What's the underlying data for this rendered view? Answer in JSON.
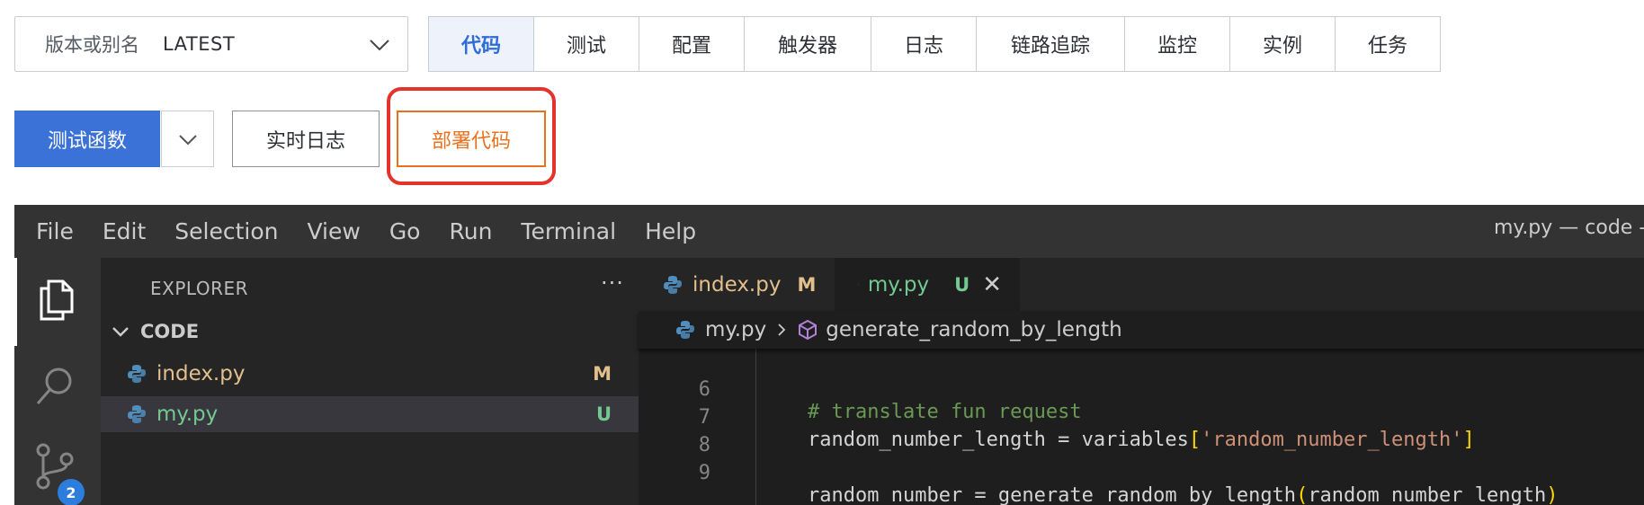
{
  "version_select": {
    "label": "版本或别名",
    "value": "LATEST"
  },
  "tabs": [
    "代码",
    "测试",
    "配置",
    "触发器",
    "日志",
    "链路追踪",
    "监控",
    "实例",
    "任务"
  ],
  "active_tab": "代码",
  "actions": {
    "test": "测试函数",
    "realtime_log": "实时日志",
    "deploy": "部署代码"
  },
  "colors": {
    "primary": "#3b72d7",
    "deploy": "#e8721f",
    "highlight": "#e5322d"
  },
  "editor": {
    "menu": [
      "File",
      "Edit",
      "Selection",
      "View",
      "Go",
      "Run",
      "Terminal",
      "Help"
    ],
    "window_title": "my.py — code -",
    "activity": {
      "scm_badge": "2",
      "icons": [
        "files-icon",
        "search-icon",
        "source-control-icon"
      ]
    },
    "explorer": {
      "title": "EXPLORER",
      "more": "···",
      "folder": "CODE",
      "files": [
        {
          "name": "index.py",
          "status": "M"
        },
        {
          "name": "my.py",
          "status": "U"
        }
      ]
    },
    "open_tabs": [
      {
        "name": "index.py",
        "status": "M"
      },
      {
        "name": "my.py",
        "status": "U",
        "close": "✕"
      }
    ],
    "breadcrumb": {
      "file": "my.py",
      "symbol": "generate_random_by_length"
    },
    "code": {
      "line_numbers": [
        "6",
        "7",
        "8",
        "9"
      ],
      "l6_comment": "# translate fun request",
      "l7_a": "random_number_length = variables",
      "l7_b": "[",
      "l7_c": "'random_number_length'",
      "l7_d": "]",
      "l9_a": "random_number = generate_random_by_length",
      "l9_b": "(",
      "l9_c": "random_number_length",
      "l9_d": ")"
    }
  }
}
